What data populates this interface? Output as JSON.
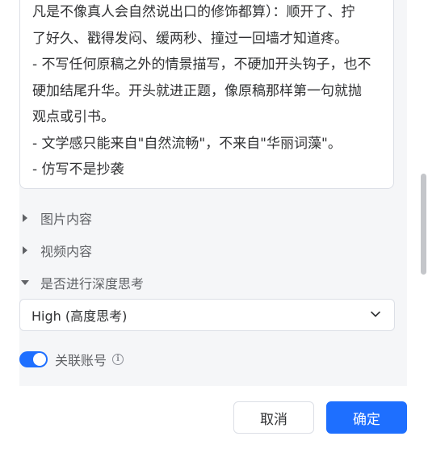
{
  "prompt_text": {
    "lines": [
      "凡是不像真人会自然说出口的修饰都算）：顺开了、拧",
      "了好久、戳得发闷、缓两秒、撞过一回墙才知道疼。",
      "- 不写任何原稿之外的情景描写，不硬加开头钩子，也不",
      "硬加结尾升华。开头就进正题，像原稿那样第一句就抛",
      "观点或引书。",
      "- 文学感只能来自\"自然流畅\"，不来自\"华丽词藻\"。",
      "- 仿写不是抄袭"
    ]
  },
  "sections": {
    "image_content": "图片内容",
    "video_content": "视频内容",
    "deep_thinking": "是否进行深度思考"
  },
  "deep_thinking_select": {
    "value": "High (高度思考)"
  },
  "link_account": {
    "label": "关联账号",
    "enabled": true
  },
  "cut_off_row": {
    "label": "..."
  },
  "footer": {
    "cancel_label": "取消",
    "confirm_label": "确定"
  },
  "colors": {
    "accent": "#1e6fff",
    "panel_bg": "#f5f6f8",
    "border": "#dcdfe6"
  }
}
